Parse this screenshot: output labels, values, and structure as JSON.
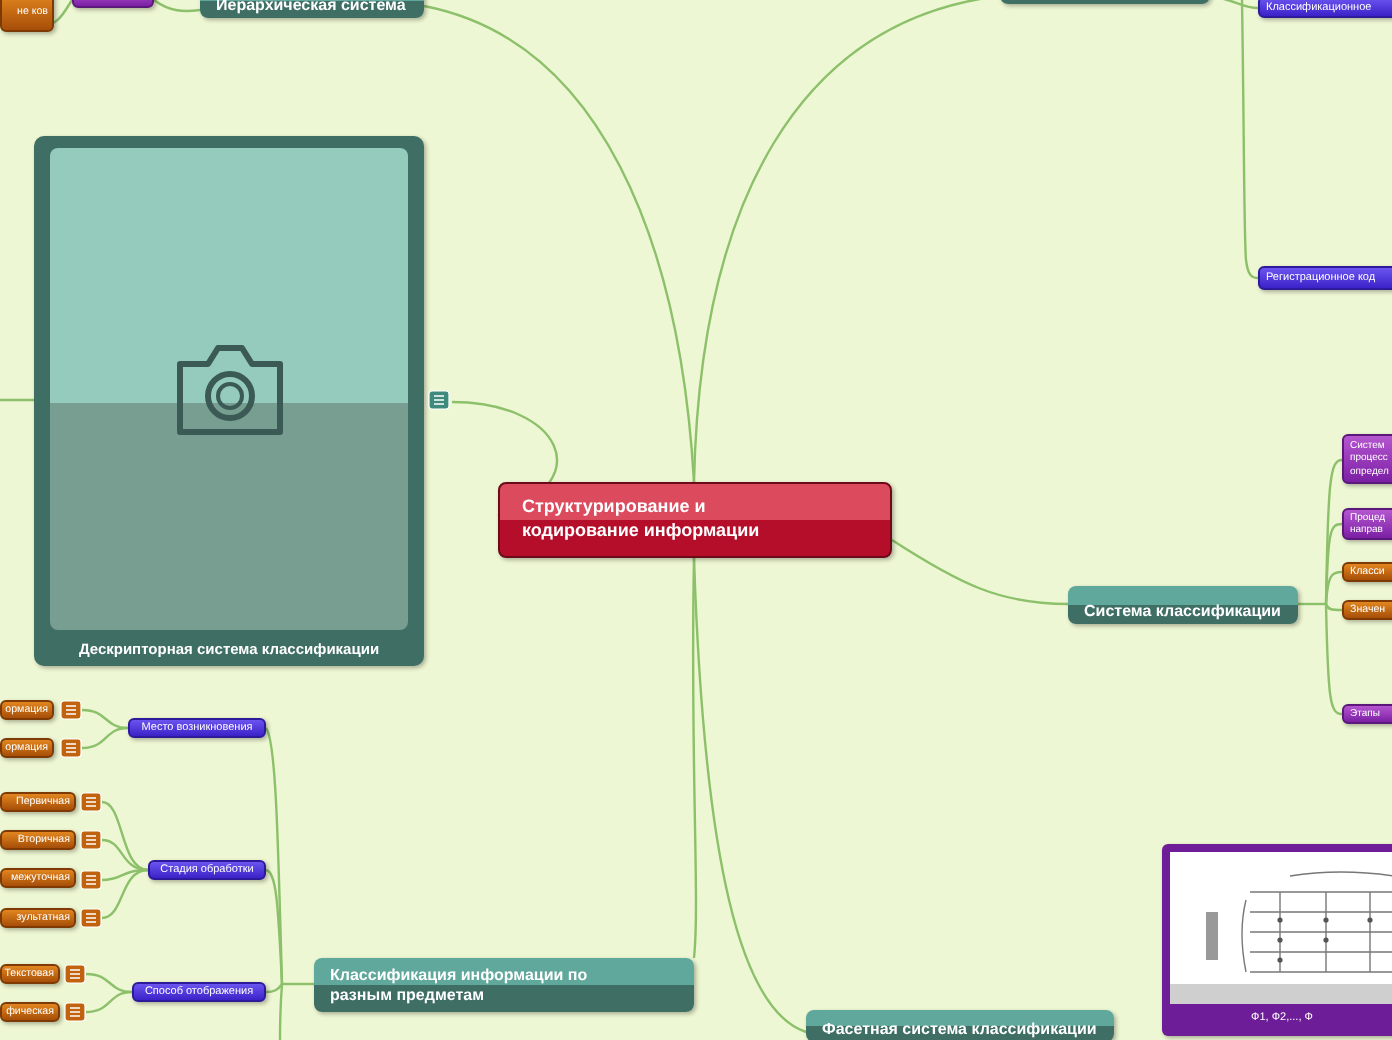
{
  "nodes": [
    {
      "kind": "leaf",
      "text": "не ков"
    },
    {
      "kind": "right"
    },
    {
      "kind": "main",
      "text": "Иерархическая система"
    },
    {
      "kind": "main"
    },
    {
      "kind": "sub",
      "text": "Классификационное"
    },
    {
      "kind": "sub",
      "text": "Регистрационное код"
    },
    {
      "kind": "card",
      "text": "Дескрипторная система классификации",
      "note": true
    },
    {
      "kind": "central",
      "text": "Структурирование и кодирование информации"
    },
    {
      "kind": "main",
      "text": "Система классификации"
    },
    {
      "kind": "right",
      "text": "Систем процесс определ"
    },
    {
      "kind": "right",
      "text": "Процед направ"
    },
    {
      "kind": "leaf",
      "text": "Класси"
    },
    {
      "kind": "leaf",
      "text": "Значен"
    },
    {
      "kind": "right",
      "text": "Этапы"
    },
    {
      "kind": "sub",
      "text": "Место возникновения"
    },
    {
      "kind": "leaf",
      "text": "ормация",
      "note": true
    },
    {
      "kind": "leaf",
      "text": "ормация",
      "note": true
    },
    {
      "kind": "sub",
      "text": "Стадия обработки"
    },
    {
      "kind": "leaf",
      "text": "Первичная",
      "note": true
    },
    {
      "kind": "leaf",
      "text": "Вторичная",
      "note": true
    },
    {
      "kind": "leaf",
      "text": "межуточная",
      "note": true
    },
    {
      "kind": "leaf",
      "text": "зультатная",
      "note": true
    },
    {
      "kind": "sub",
      "text": "Способ отображения"
    },
    {
      "kind": "leaf",
      "text": "Текстовая",
      "note": true
    },
    {
      "kind": "leaf",
      "text": "фическая",
      "note": true
    },
    {
      "kind": "main",
      "text": "Классификация информации по разным предметам"
    },
    {
      "text": "Ф1, Ф2,..., Ф"
    },
    {
      "kind": "main",
      "text": "Фасетная система классификации"
    }
  ]
}
